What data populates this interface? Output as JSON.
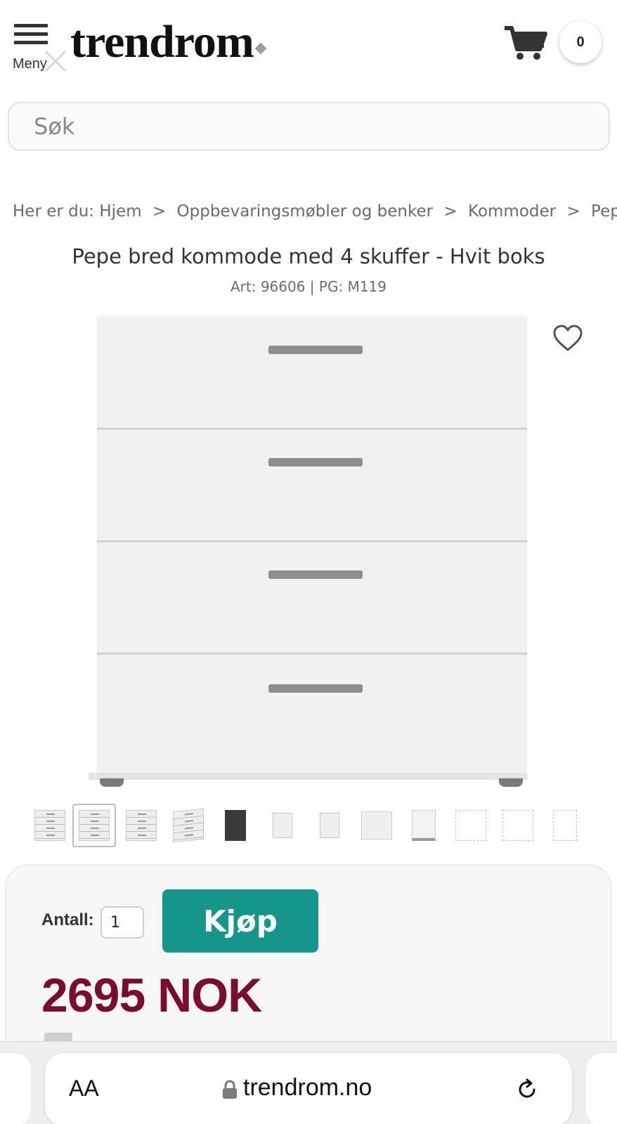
{
  "header": {
    "menu_label": "Meny",
    "logo_text": "trendrom",
    "cart_count": "0"
  },
  "search": {
    "placeholder": "Søk"
  },
  "breadcrumb": {
    "prefix": "Her er du:",
    "items": [
      "Hjem",
      "Oppbevaringsmøbler og benker",
      "Kommoder",
      "Pepe"
    ],
    "separator": ">"
  },
  "product": {
    "title": "Pepe bred kommode med 4 skuffer - Hvit boks",
    "art_info": "Art: 96606 | PG: M119",
    "drawer_count": 4,
    "thumbnail_count": 12,
    "selected_thumbnail": 2
  },
  "buy": {
    "qty_label": "Antall:",
    "qty_value": "1",
    "buy_label": "Kjøp",
    "price": "2695 NOK"
  },
  "browser": {
    "text_size_label": "AA",
    "url": "trendrom.no"
  },
  "colors": {
    "buy_button": "#16968a",
    "price": "#7a0c2e"
  },
  "icons": [
    "menu-icon",
    "close-icon",
    "cart-icon",
    "heart-icon",
    "lock-icon",
    "reload-icon"
  ]
}
